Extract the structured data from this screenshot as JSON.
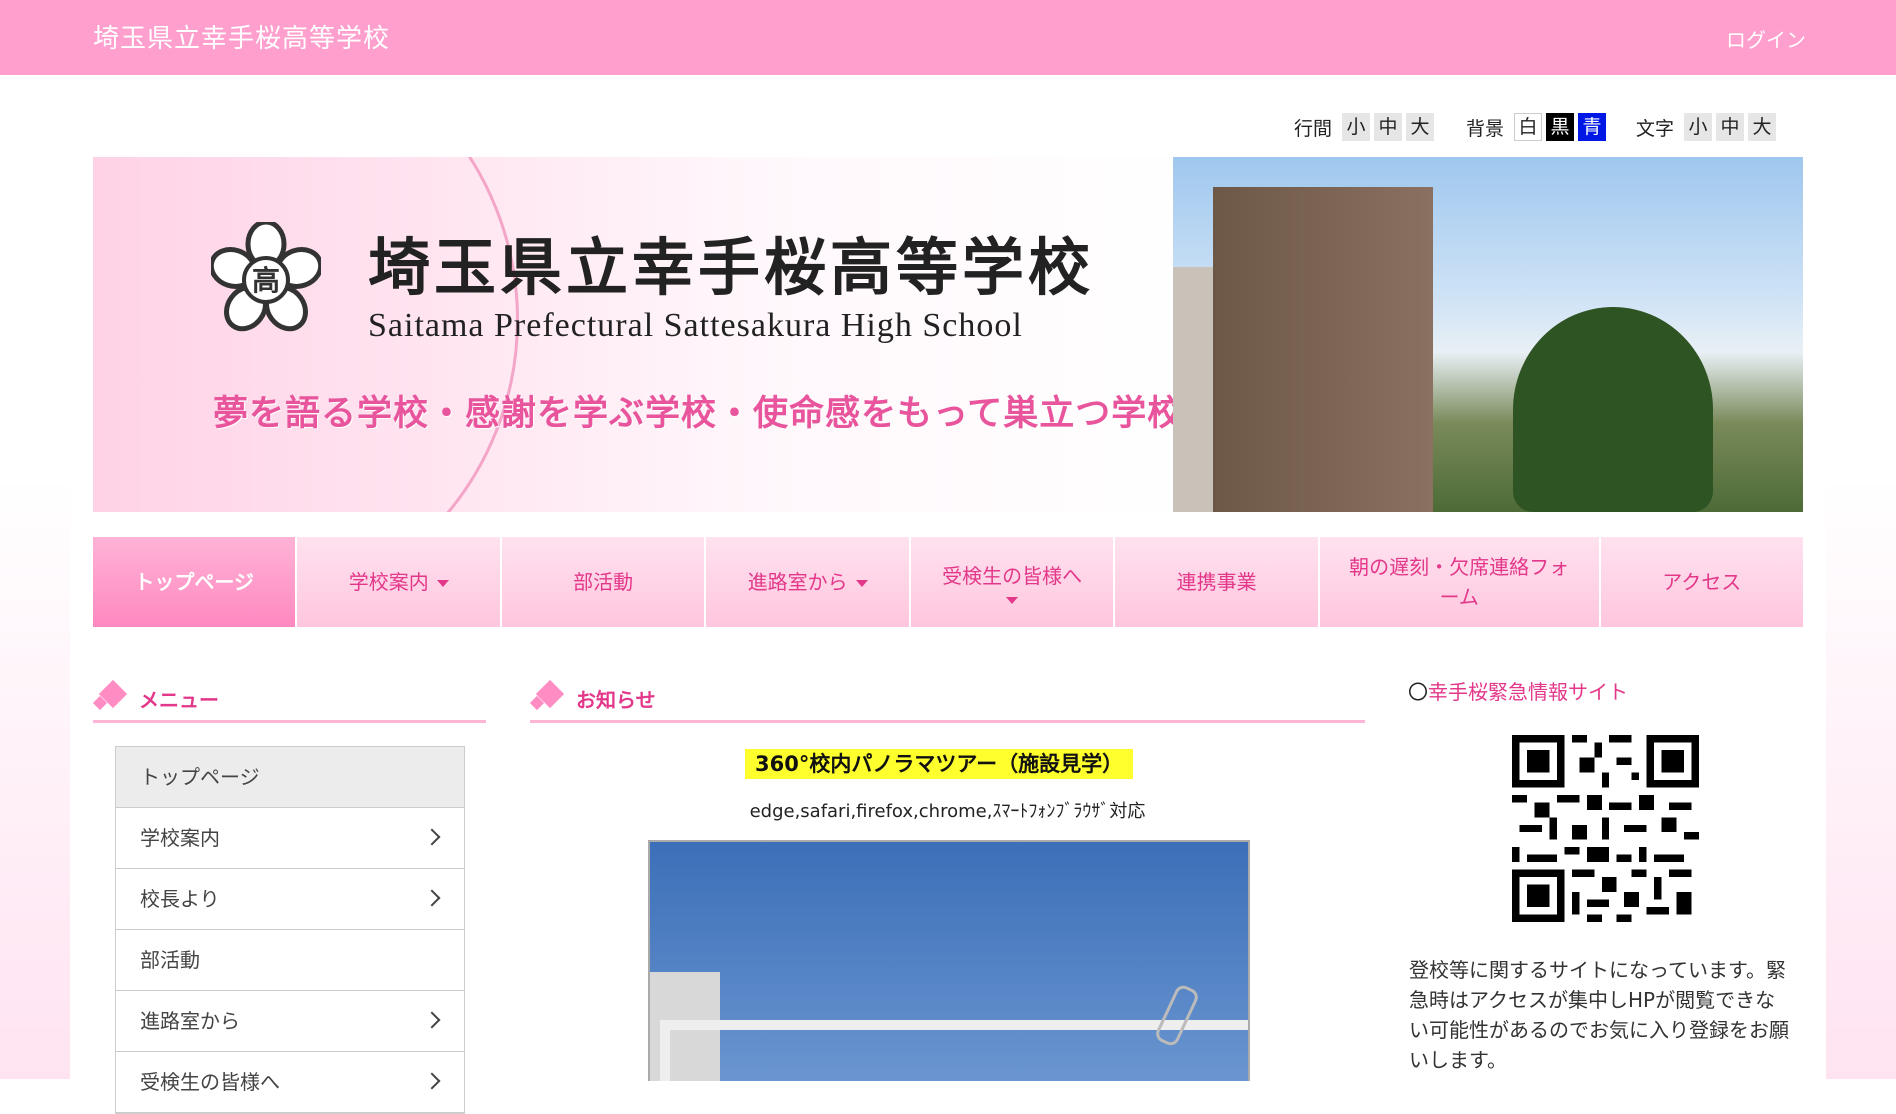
{
  "header": {
    "site_title": "埼玉県立幸手桜高等学校",
    "login": "ログイン"
  },
  "controls": {
    "line_spacing": {
      "label": "行間",
      "options": [
        "小",
        "中",
        "大"
      ]
    },
    "background": {
      "label": "背景",
      "options": [
        "白",
        "黒",
        "青"
      ]
    },
    "text_size": {
      "label": "文字",
      "options": [
        "小",
        "中",
        "大"
      ]
    }
  },
  "banner": {
    "crest_text": "高",
    "title_jp": "埼玉県立幸手桜高等学校",
    "title_en": "Saitama Prefectural Sattesakura High School",
    "motto": "夢を語る学校・感謝を学ぶ学校・使命感をもって巣立つ学校"
  },
  "nav": [
    {
      "label": "トップページ",
      "active": true
    },
    {
      "label": "学校案内",
      "dropdown": true
    },
    {
      "label": "部活動"
    },
    {
      "label": "進路室から",
      "dropdown": true
    },
    {
      "label": "受検生の皆様へ",
      "dropdown": true
    },
    {
      "label": "連携事業"
    },
    {
      "label": "朝の遅刻・欠席連絡フォーム"
    },
    {
      "label": "アクセス"
    }
  ],
  "menu": {
    "heading": "メニュー",
    "items": [
      "トップページ",
      "学校案内",
      "校長より",
      "部活動",
      "進路室から",
      "受検生の皆様へ"
    ]
  },
  "news": {
    "heading": "お知らせ",
    "title": "360°校内パノラマツアー（施設見学）",
    "subtitle": "edge,safari,firefox,chrome,ｽﾏｰﾄﾌｫﾝﾌﾞﾗｳｻﾞ対応"
  },
  "sidebar_right": {
    "link_prefix": "〇",
    "link_text": "幸手桜緊急情報サイト",
    "description": "登校等に関するサイトになっています。緊急時はアクセスが集中しHPが閲覧できない可能性があるのでお気に入り登録をお願いします。"
  },
  "colors": {
    "header": "#ff9fcd",
    "accent": "#e3388a",
    "nav_bg": "#ffd3e6",
    "highlight": "#ffff2e"
  }
}
